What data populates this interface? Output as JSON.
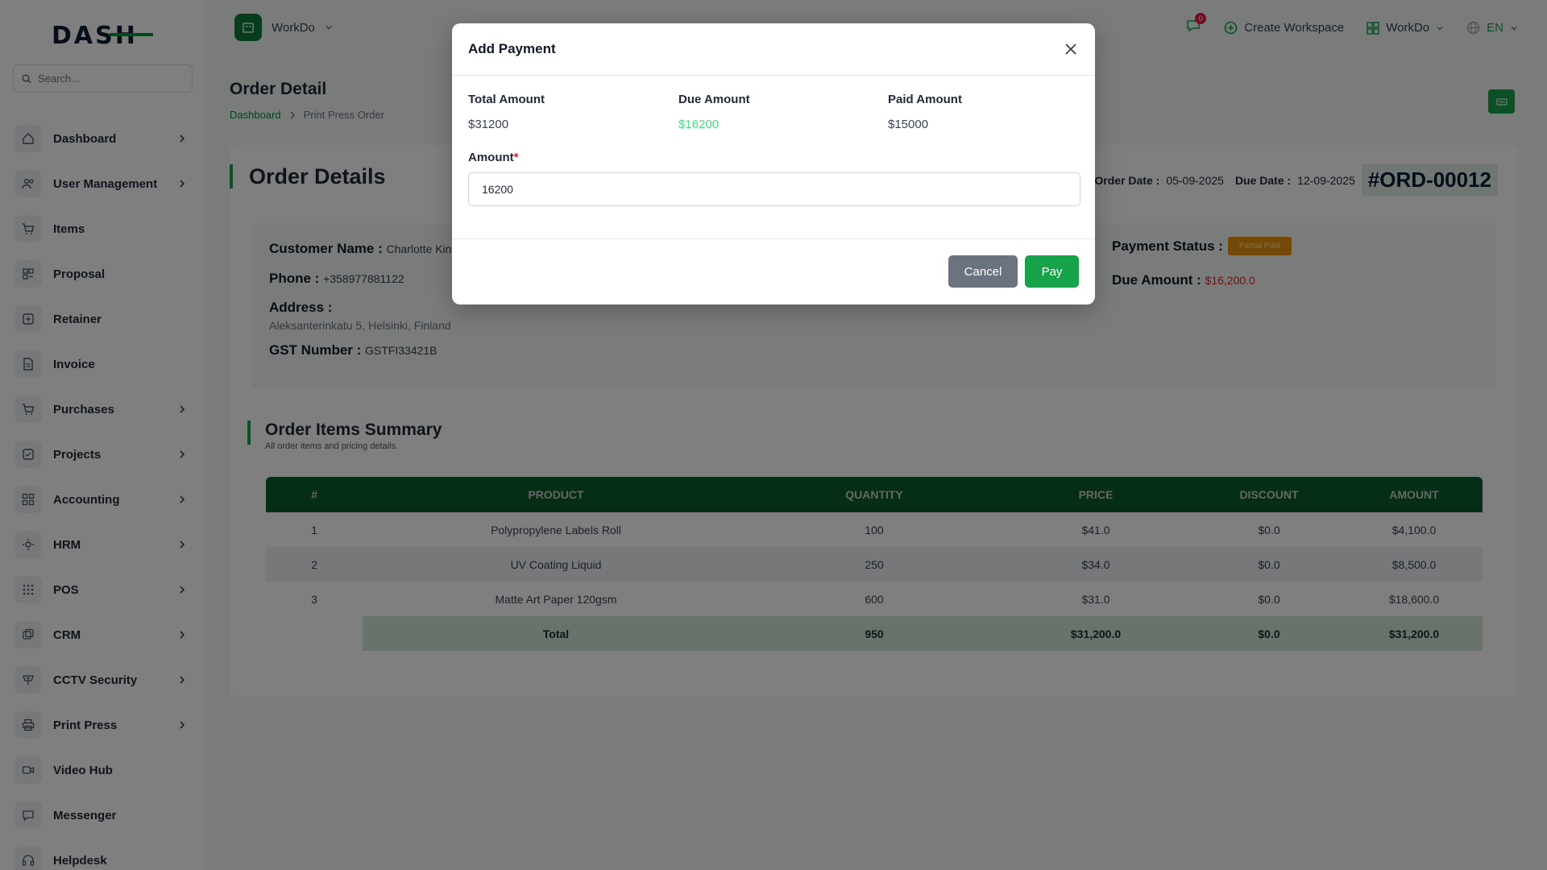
{
  "brand": {
    "logo_text_main": "DASH",
    "logo_text_accent": ""
  },
  "search": {
    "placeholder": "Search..."
  },
  "sidebar": {
    "items": [
      {
        "label": "Dashboard",
        "icon": "home-icon",
        "has_children": true
      },
      {
        "label": "User Management",
        "icon": "users-icon",
        "has_children": true
      },
      {
        "label": "Items",
        "icon": "cart-icon",
        "has_children": false
      },
      {
        "label": "Proposal",
        "icon": "proposal-icon",
        "has_children": false
      },
      {
        "label": "Retainer",
        "icon": "retainer-icon",
        "has_children": false
      },
      {
        "label": "Invoice",
        "icon": "invoice-icon",
        "has_children": false
      },
      {
        "label": "Purchases",
        "icon": "cart-icon",
        "has_children": true
      },
      {
        "label": "Projects",
        "icon": "projects-icon",
        "has_children": true
      },
      {
        "label": "Accounting",
        "icon": "grid-icon",
        "has_children": true
      },
      {
        "label": "HRM",
        "icon": "hrm-icon",
        "has_children": true
      },
      {
        "label": "POS",
        "icon": "dots-grid-icon",
        "has_children": true
      },
      {
        "label": "CRM",
        "icon": "crm-icon",
        "has_children": true
      },
      {
        "label": "CCTV Security",
        "icon": "cctv-icon",
        "has_children": true
      },
      {
        "label": "Print Press",
        "icon": "printer-icon",
        "has_children": true
      },
      {
        "label": "Video Hub",
        "icon": "video-icon",
        "has_children": false
      },
      {
        "label": "Messenger",
        "icon": "chat-icon",
        "has_children": false
      },
      {
        "label": "Helpdesk",
        "icon": "headset-icon",
        "has_children": false
      }
    ]
  },
  "topbar": {
    "workspace_name": "WorkDo",
    "notification_count": "0",
    "create_workspace": "Create Workspace",
    "workspace_menu": "WorkDo",
    "language": "EN"
  },
  "page": {
    "title": "Order Detail",
    "breadcrumb_home": "Dashboard",
    "breadcrumb_current": "Print Press Order"
  },
  "order": {
    "section_title": "Order Details",
    "order_date_label": "Order Date :",
    "order_date": "05-09-2025",
    "due_date_label": "Due Date :",
    "due_date": "12-09-2025",
    "order_id": "#ORD-00012",
    "customer_label": "Customer Name :",
    "customer_name": "Charlotte King",
    "phone_label": "Phone :",
    "phone": "+358977881122",
    "address_label": "Address :",
    "address": "Aleksanterinkatu 5, Helsinki, Finland",
    "gst_label": "GST Number :",
    "gst": "GSTFI33421B",
    "payment_status_label": "Payment Status :",
    "payment_status": "Partial Paid",
    "due_amount_label": "Due Amount :",
    "due_amount": "$16,200.0"
  },
  "summary": {
    "title": "Order Items Summary",
    "subtitle": "All order items and pricing details.",
    "columns": [
      "#",
      "PRODUCT",
      "QUANTITY",
      "PRICE",
      "DISCOUNT",
      "AMOUNT"
    ],
    "rows": [
      {
        "n": "1",
        "product": "Polypropylene Labels Roll",
        "qty": "100",
        "price": "$41.0",
        "discount": "$0.0",
        "amount": "$4,100.0"
      },
      {
        "n": "2",
        "product": "UV Coating Liquid",
        "qty": "250",
        "price": "$34.0",
        "discount": "$0.0",
        "amount": "$8,500.0"
      },
      {
        "n": "3",
        "product": "Matte Art Paper 120gsm",
        "qty": "600",
        "price": "$31.0",
        "discount": "$0.0",
        "amount": "$18,600.0"
      }
    ],
    "total": {
      "label": "Total",
      "qty": "950",
      "price": "$31,200.0",
      "discount": "$0.0",
      "amount": "$31,200.0"
    }
  },
  "modal": {
    "title": "Add Payment",
    "total_label": "Total Amount",
    "total_value": "$31200",
    "due_label": "Due Amount",
    "due_value": "$16200",
    "paid_label": "Paid Amount",
    "paid_value": "$15000",
    "amount_label": "Amount",
    "amount_required": "*",
    "amount_value": "16200",
    "cancel_label": "Cancel",
    "pay_label": "Pay"
  },
  "colors": {
    "brand_green": "#16a34a",
    "table_header": "#0d5c2e",
    "status_orange": "#e8910e",
    "due_red": "#dc2626"
  }
}
